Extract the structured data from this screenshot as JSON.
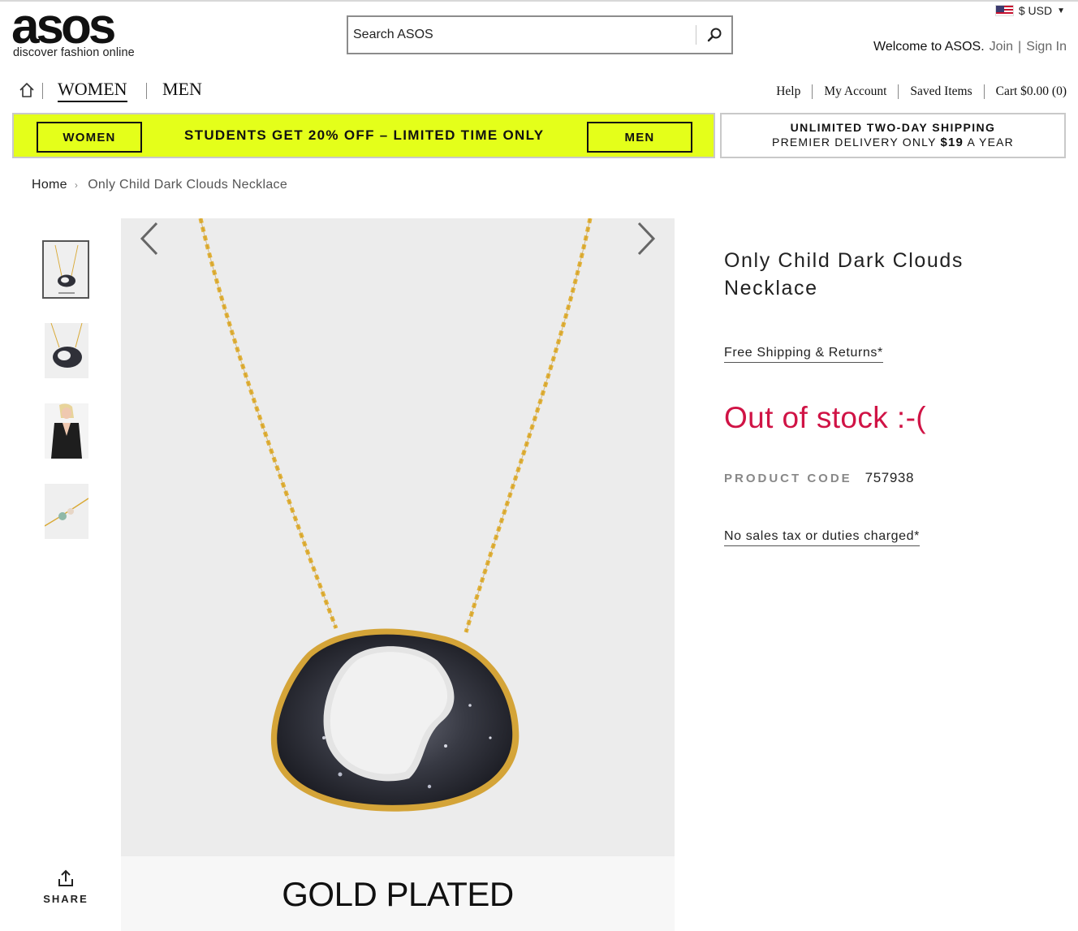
{
  "header": {
    "logo_word": "asos",
    "logo_tagline": "discover fashion online",
    "search_placeholder": "Search ASOS",
    "currency": "$ USD",
    "welcome_text": "Welcome to ASOS.",
    "join_label": "Join",
    "signin_label": "Sign In",
    "auth_separator": "|"
  },
  "nav": {
    "women_label": "WOMEN",
    "men_label": "MEN",
    "utility": {
      "help": "Help",
      "account": "My Account",
      "saved": "Saved Items",
      "cart": "Cart $0.00 (0)"
    }
  },
  "promo": {
    "women_button": "WOMEN",
    "men_button": "MEN",
    "message": "STUDENTS GET 20% OFF – LIMITED TIME ONLY",
    "shipping_line1": "UNLIMITED TWO-DAY SHIPPING",
    "shipping_line2_prefix": "PREMIER DELIVERY ONLY",
    "shipping_price": "$19",
    "shipping_line2_suffix": "A YEAR"
  },
  "breadcrumb": {
    "home": "Home",
    "separator": "›",
    "current": "Only Child Dark Clouds Necklace"
  },
  "gallery": {
    "thumbnail_count": 4,
    "active_index": 0,
    "main_caption": "GOLD PLATED",
    "share_label": "SHARE"
  },
  "product": {
    "title": "Only Child Dark Clouds Necklace",
    "free_shipping": "Free Shipping & Returns*",
    "stock_status": "Out of stock :-(",
    "product_code_label": "PRODUCT CODE",
    "product_code": "757938",
    "tax_note": "No sales tax or duties charged*"
  },
  "colors": {
    "promo_yellow": "#e4ff1a",
    "out_of_stock_red": "#d01345",
    "gold_chain": "#e2b23a",
    "stone_dark": "#2f3038"
  }
}
